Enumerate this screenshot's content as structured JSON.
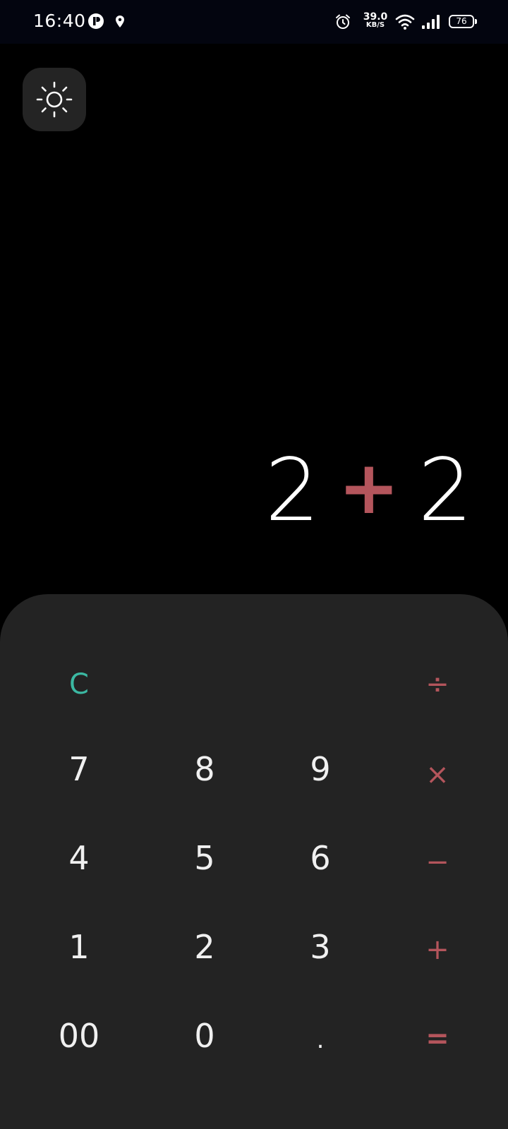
{
  "status_bar": {
    "time": "16:40",
    "net_speed_value": "39.0",
    "net_speed_unit": "KB/S",
    "battery_level": "76",
    "icons": [
      "app-notification-icon",
      "location-icon",
      "alarm-icon",
      "wifi-icon",
      "signal-icon",
      "battery-icon"
    ]
  },
  "theme_toggle": {
    "icon": "sun-icon"
  },
  "display": {
    "operand_left": "2",
    "operator": "+",
    "operand_right": "2"
  },
  "colors": {
    "background": "#000000",
    "keypad": "#232323",
    "operator_accent": "#b4555c",
    "clear_accent": "#3bb8a2",
    "digit_text": "#f0f0f0"
  },
  "keys": {
    "clear": "C",
    "divide": "÷",
    "seven": "7",
    "eight": "8",
    "nine": "9",
    "multiply": "×",
    "four": "4",
    "five": "5",
    "six": "6",
    "minus": "−",
    "one": "1",
    "two": "2",
    "three": "3",
    "plus": "+",
    "double_zero": "00",
    "zero": "0",
    "dot": ".",
    "equals": "="
  }
}
